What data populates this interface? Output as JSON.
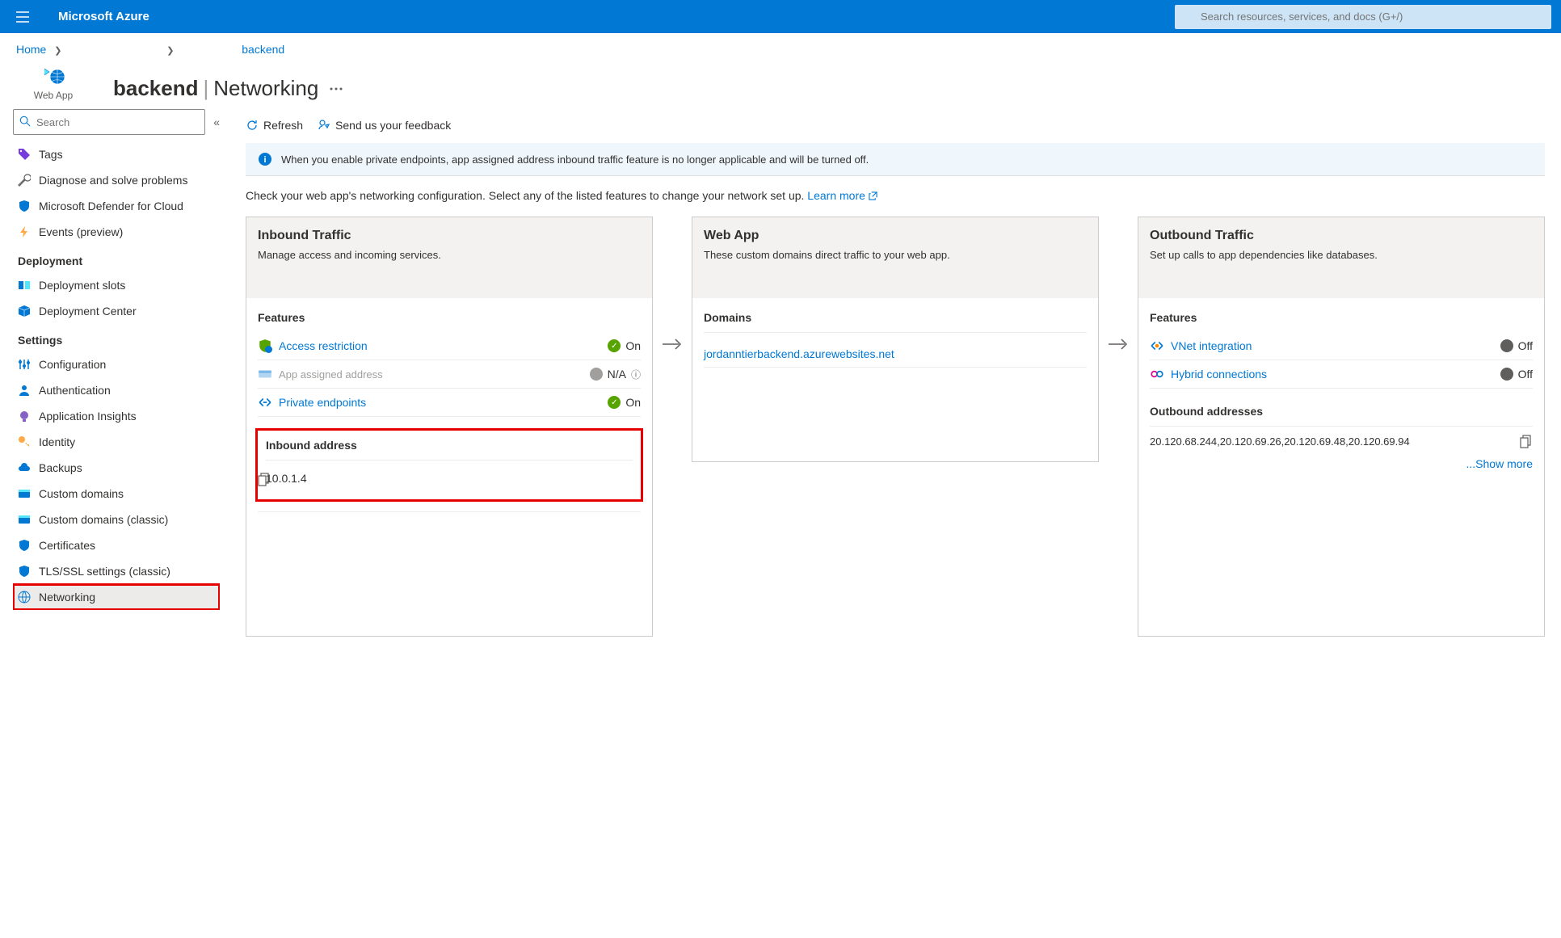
{
  "header": {
    "brand": "Microsoft Azure",
    "search_placeholder": "Search resources, services, and docs (G+/)"
  },
  "breadcrumb": {
    "home": "Home",
    "resource": "backend"
  },
  "resource": {
    "name": "backend",
    "page": "Networking",
    "type": "Web App"
  },
  "sidebar": {
    "search_placeholder": "Search",
    "items": {
      "tags": "Tags",
      "diagnose": "Diagnose and solve problems",
      "defender": "Microsoft Defender for Cloud",
      "events": "Events (preview)"
    },
    "deployment_header": "Deployment",
    "deployment": {
      "slots": "Deployment slots",
      "center": "Deployment Center"
    },
    "settings_header": "Settings",
    "settings": {
      "config": "Configuration",
      "auth": "Authentication",
      "insights": "Application Insights",
      "identity": "Identity",
      "backups": "Backups",
      "custom_domains": "Custom domains",
      "custom_domains_classic": "Custom domains (classic)",
      "certificates": "Certificates",
      "tls": "TLS/SSL settings (classic)",
      "networking": "Networking"
    }
  },
  "toolbar": {
    "refresh": "Refresh",
    "feedback": "Send us your feedback"
  },
  "banner": "When you enable private endpoints, app assigned address inbound traffic feature is no longer applicable and will be turned off.",
  "intro": {
    "text": "Check your web app's networking configuration. Select any of the listed features to change your network set up. ",
    "link": "Learn more"
  },
  "cards": {
    "inbound": {
      "title": "Inbound Traffic",
      "desc": "Manage access and incoming services.",
      "features_label": "Features",
      "access_restriction": "Access restriction",
      "app_assigned": "App assigned address",
      "private_endpoints": "Private endpoints",
      "on": "On",
      "na": "N/A",
      "inbound_address_label": "Inbound address",
      "inbound_address": "10.0.1.4"
    },
    "webapp": {
      "title": "Web App",
      "desc": "These custom domains direct traffic to your web app.",
      "domains_label": "Domains",
      "domain": "jordanntierbackend.azurewebsites.net"
    },
    "outbound": {
      "title": "Outbound Traffic",
      "desc": "Set up calls to app dependencies like databases.",
      "features_label": "Features",
      "vnet": "VNet integration",
      "hybrid": "Hybrid connections",
      "off": "Off",
      "addresses_label": "Outbound addresses",
      "addresses": "20.120.68.244,20.120.69.26,20.120.69.48,20.120.69.94",
      "show_more": "...Show more"
    }
  }
}
